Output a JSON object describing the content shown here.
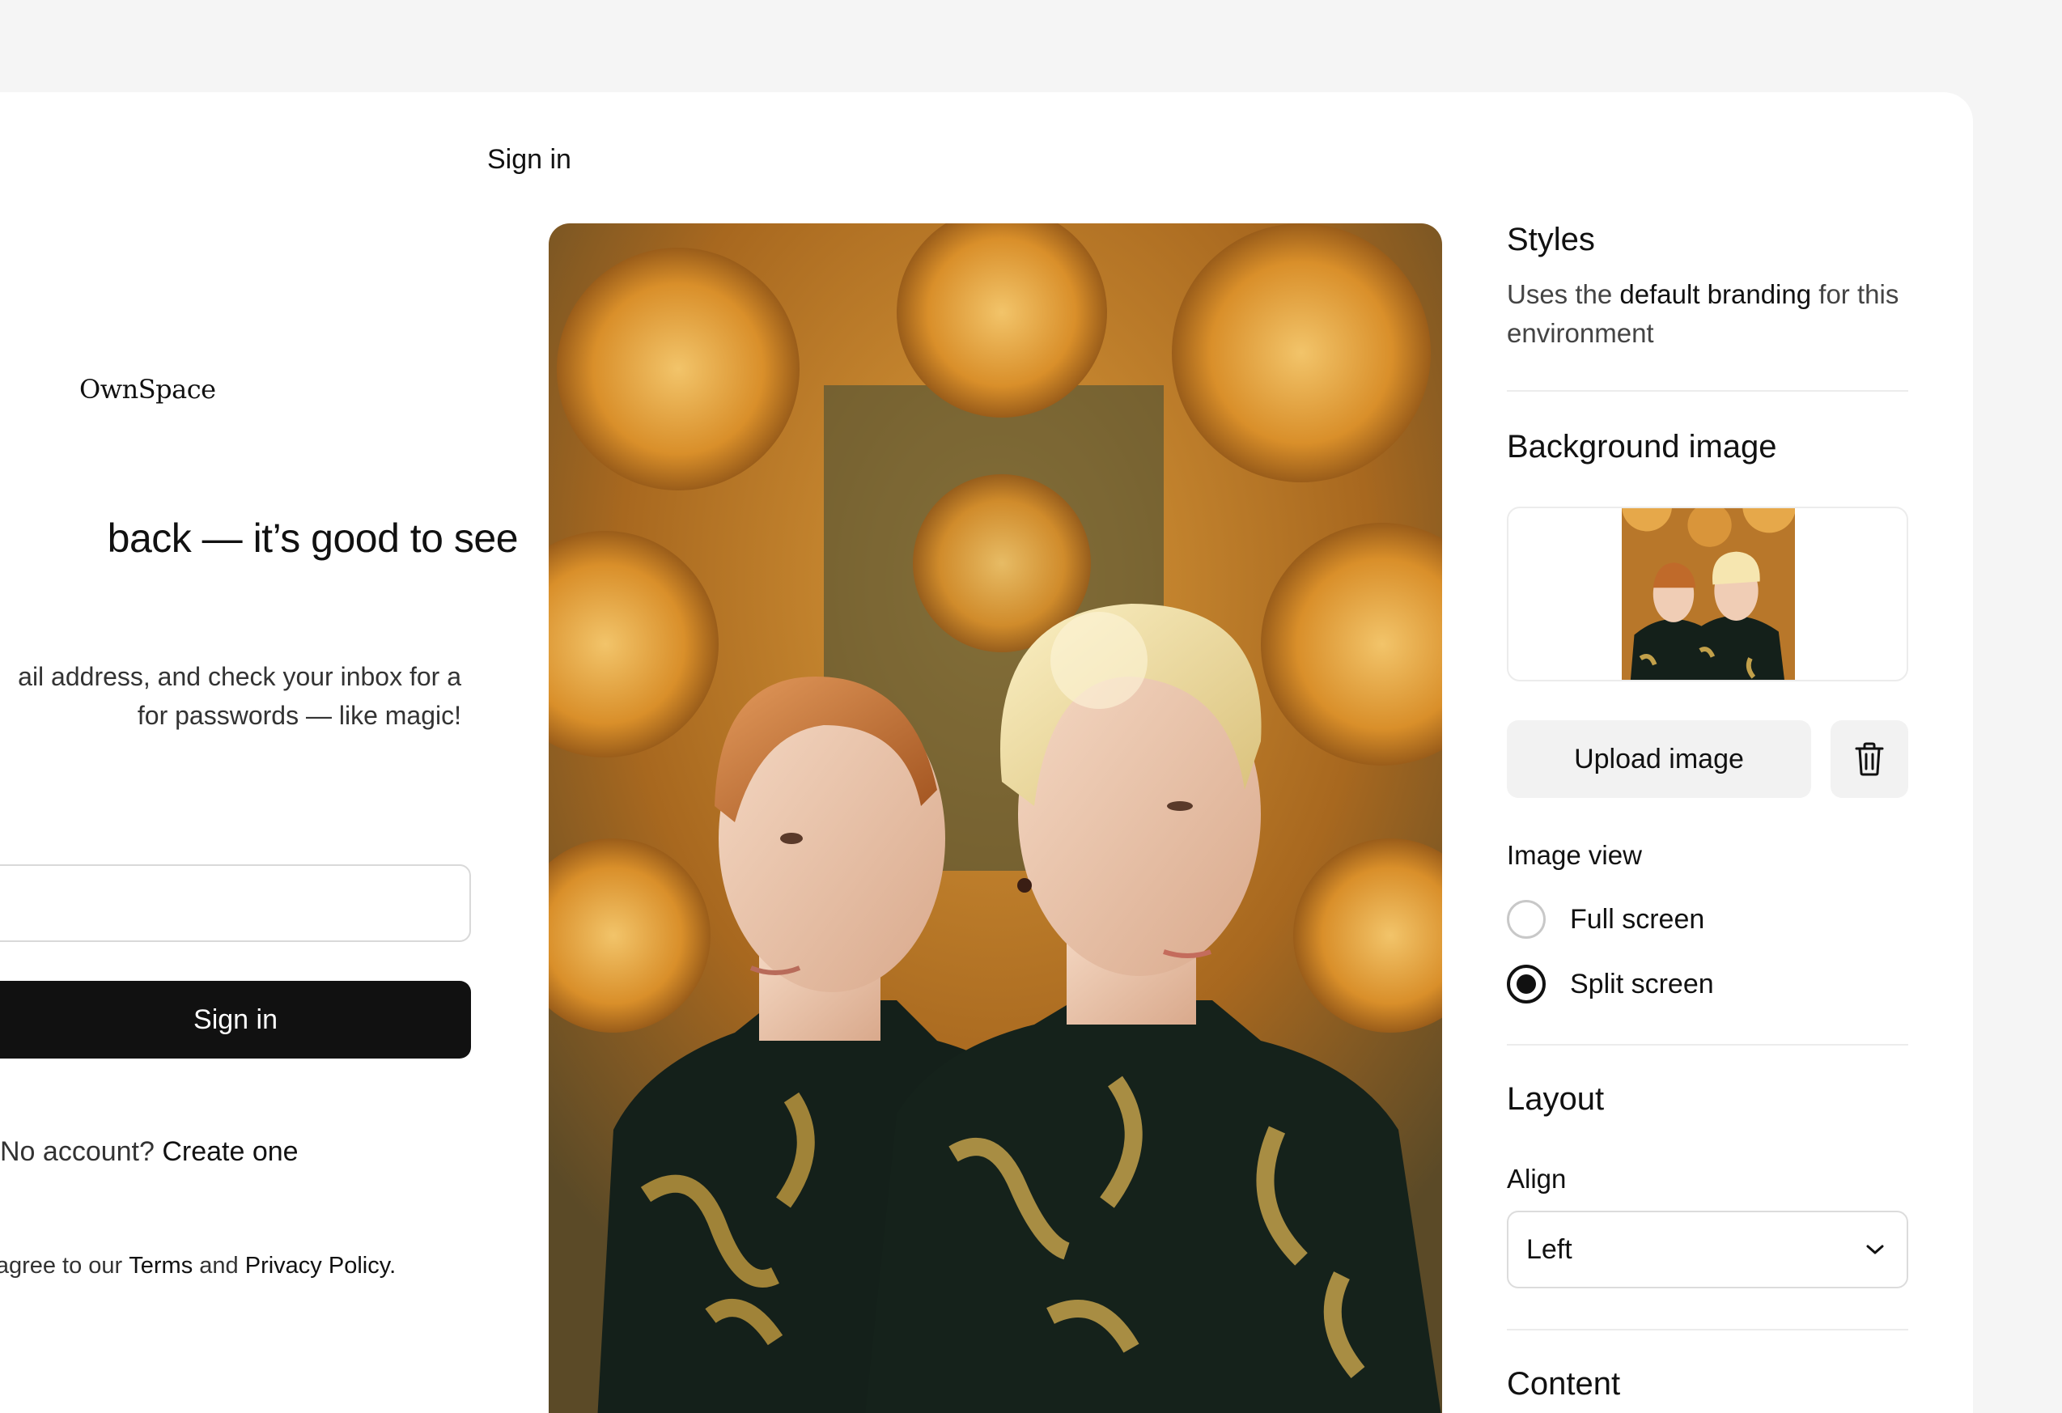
{
  "header": {
    "title": "Sign in"
  },
  "signin": {
    "logo": "OwnSpace",
    "welcome": "back — it’s good to see",
    "desc_line1": "ail address, and check your inbox for a",
    "desc_line2": "for passwords — like magic!",
    "email_value": "",
    "button_label": "Sign in",
    "no_account": "No account?",
    "create_link": "Create one",
    "terms_prefix": "you agree to our",
    "terms_link": "Terms",
    "terms_and": "and",
    "privacy_link": "Privacy Policy."
  },
  "settings": {
    "styles": {
      "title": "Styles",
      "desc_prefix": "Uses the",
      "desc_bold": "default branding",
      "desc_suffix": "for this environment"
    },
    "background": {
      "title": "Background image",
      "upload_label": "Upload image",
      "trash_icon": "trash-icon"
    },
    "image_view": {
      "label": "Image view",
      "options": [
        {
          "label": "Full screen",
          "checked": false
        },
        {
          "label": "Split screen",
          "checked": true
        }
      ]
    },
    "layout": {
      "title": "Layout",
      "align_label": "Align",
      "align_value": "Left"
    },
    "content": {
      "title": "Content"
    }
  },
  "colors": {
    "primary": "#111111",
    "gold": "#c98a2a",
    "dark_green": "#142019"
  }
}
